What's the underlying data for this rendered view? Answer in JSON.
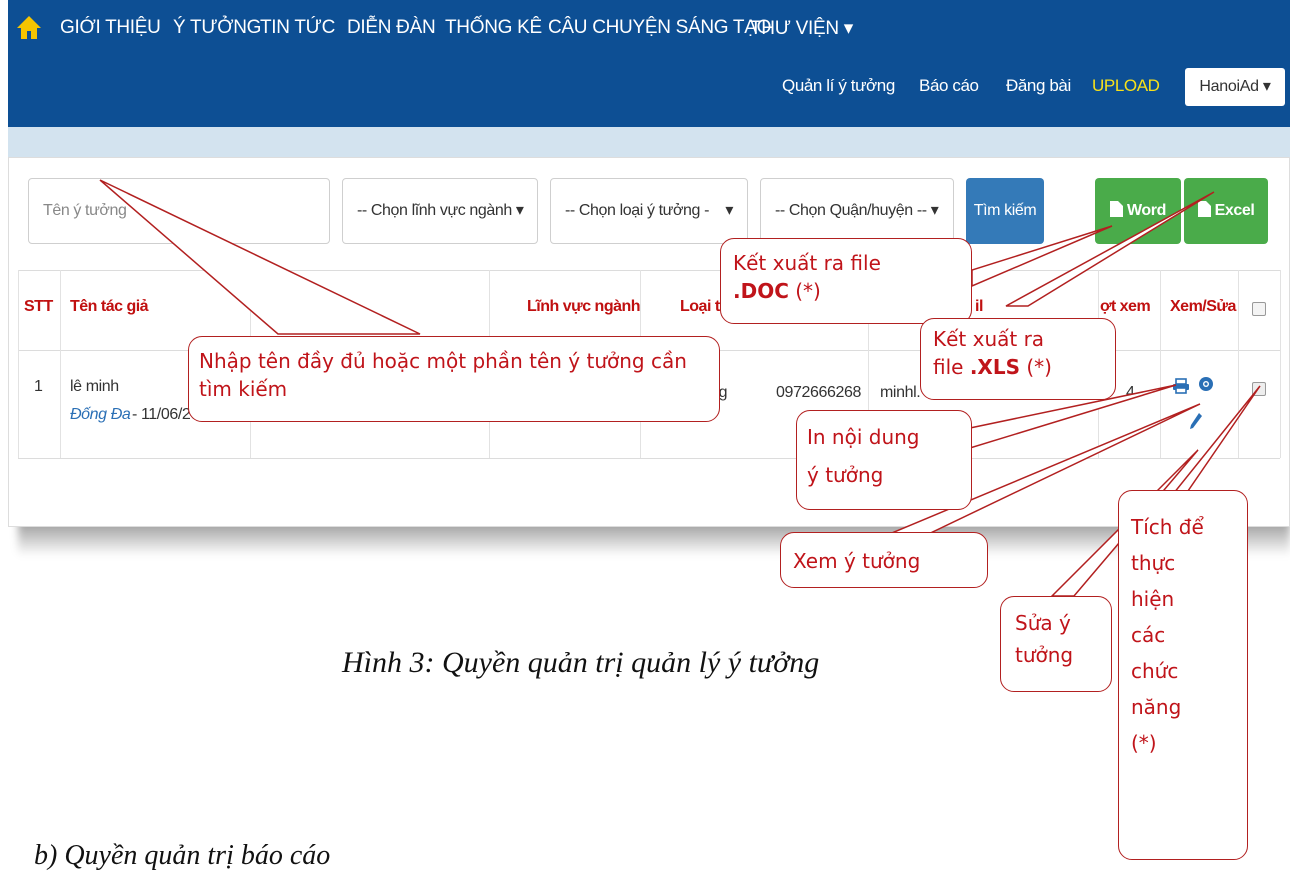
{
  "nav": {
    "items": [
      "GIỚI THIỆU",
      "Ý TƯỞNG",
      "TIN TỨC",
      "DIỄN ĐÀN",
      "THỐNG KÊ",
      "CÂU CHUYỆN SÁNG TẠO",
      "THƯ VIỆN ▾"
    ],
    "sub_items": [
      "Quản lí ý tưởng",
      "Báo cáo",
      "Đăng bài",
      "UPLOAD"
    ],
    "user": "HanoiAd ▾",
    "colors": {
      "bar": "#0d4f94",
      "upload": "#f7e11a",
      "home_icon": "#f5c400"
    }
  },
  "filters": {
    "search_placeholder": "Tên ý tưởng",
    "field": "-- Chọn lĩnh vực ngành ▾",
    "type": "-- Chọn loại ý tưởng -",
    "type_caret": "▾",
    "district": "-- Chọn Quận/huyện -- ▾",
    "search_button": "Tìm kiếm",
    "word_button": "Word",
    "excel_button": "Excel"
  },
  "table": {
    "headers": {
      "stt": "STT",
      "author": "Tên tác giả",
      "field": "Lĩnh vực ngành",
      "type": "Loại tí",
      "email": "il",
      "views": "ợt xem",
      "action": "Xem/Sửa"
    },
    "row": {
      "stt": "1",
      "author": "lê minh",
      "district": "Đống Đa",
      "date": " - 11/06/2016",
      "type": "ởng",
      "phone": "0972666268",
      "email": "minhl.",
      "views": "4"
    }
  },
  "callouts": {
    "search": "Nhập tên đầy đủ hoặc một phần tên ý tưởng cần tìm kiếm",
    "doc_line1": "Kết xuất ra file",
    "doc_ext": ".DOC",
    "doc_star": " (*)",
    "xls_line1": "Kết xuất ra",
    "xls_prefix": "file ",
    "xls_ext": ".XLS",
    "xls_star": " (*)",
    "print_line1": "In nội dung",
    "print_line2": "ý tưởng",
    "view": "Xem ý tưởng",
    "edit_line1": "Sửa ý",
    "edit_line2": "tưởng",
    "check_lines": [
      "Tích để",
      "thực",
      "hiện",
      "các",
      "chức",
      "năng",
      "(*)"
    ]
  },
  "caption": "Hình 3: Quyền quản trị quản lý ý tưởng",
  "section_heading": "b) Quyền quản trị báo cáo"
}
